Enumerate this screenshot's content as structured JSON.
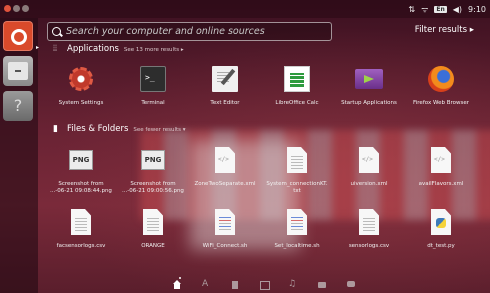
{
  "panel": {
    "keyboard_layout": "En",
    "volume_symbol": "◀)",
    "clock": "9:10",
    "network_symbol": "⇅",
    "wifi_symbol": "ᯤ"
  },
  "launcher": {
    "items": [
      {
        "name": "dash-home"
      },
      {
        "name": "files"
      },
      {
        "name": "help",
        "glyph": "?"
      }
    ]
  },
  "search": {
    "placeholder": "Search your computer and online sources",
    "filter_label": "Filter results ▸"
  },
  "applications": {
    "title": "Applications",
    "more": "See 13 more results ▸",
    "items": [
      {
        "label": "System Settings",
        "icon": "settings-icon"
      },
      {
        "label": "Terminal",
        "icon": "terminal-icon"
      },
      {
        "label": "Text Editor",
        "icon": "text-editor-icon"
      },
      {
        "label": "LibreOffice Calc",
        "icon": "libreoffice-calc-icon"
      },
      {
        "label": "Startup Applications",
        "icon": "startup-applications-icon"
      },
      {
        "label": "Firefox Web Browser",
        "icon": "firefox-icon"
      }
    ]
  },
  "files": {
    "title": "Files & Folders",
    "fewer": "See fewer results ▾",
    "png_text": "PNG",
    "row1": [
      {
        "line1": "Screenshot from",
        "line2": "...-06-21 09:08:44.png",
        "icon": "png-file-icon"
      },
      {
        "line1": "Screenshot from",
        "line2": "...-06-21 09:00:56.png",
        "icon": "png-file-icon"
      },
      {
        "line1": "ZoneTwoSeparate.xml",
        "line2": "",
        "icon": "xml-file-icon"
      },
      {
        "line1": "System_connectionKT.",
        "line2": "txt",
        "icon": "text-file-icon"
      },
      {
        "line1": "uiversion.xml",
        "line2": "",
        "icon": "xml-file-icon"
      },
      {
        "line1": "availFlavors.xml",
        "line2": "",
        "icon": "xml-file-icon"
      }
    ],
    "row2": [
      {
        "label": "facsensorlogs.csv",
        "icon": "csv-file-icon"
      },
      {
        "label": "ORANGE",
        "icon": "text-file-icon"
      },
      {
        "label": "WiFi_Connect.sh",
        "icon": "shell-script-icon"
      },
      {
        "label": "Set_localtime.sh",
        "icon": "shell-script-icon"
      },
      {
        "label": "sensorlogs.csv",
        "icon": "csv-file-icon"
      },
      {
        "label": "dt_test.py",
        "icon": "python-file-icon"
      }
    ]
  },
  "scopes": [
    "home",
    "applications",
    "files",
    "video",
    "music",
    "photos",
    "social"
  ]
}
